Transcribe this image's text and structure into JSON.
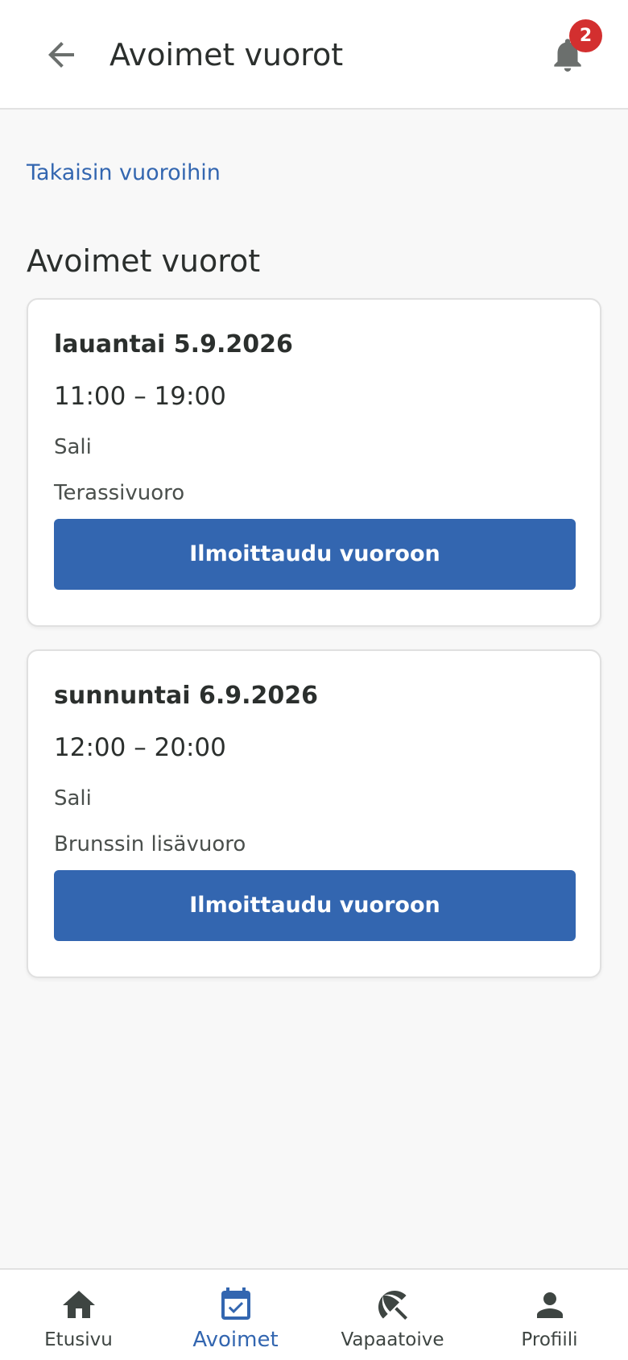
{
  "header": {
    "title": "Avoimet vuorot",
    "back_icon": "arrow-left-icon",
    "bell_icon": "bell-icon",
    "notification_count": "2"
  },
  "back_link": "Takaisin vuoroihin",
  "section_title": "Avoimet vuorot",
  "shifts": [
    {
      "date": "lauantai 5.9.2026",
      "time": "11:00 – 19:00",
      "location": "Sali",
      "description": "Terassivuoro",
      "button_label": "Ilmoittaudu vuoroon"
    },
    {
      "date": "sunnuntai 6.9.2026",
      "time": "12:00 – 20:00",
      "location": "Sali",
      "description": "Brunssin lisävuoro",
      "button_label": "Ilmoittaudu vuoroon"
    }
  ],
  "bottom_nav": {
    "items": [
      {
        "label": "Etusivu",
        "icon": "home-icon",
        "active": false
      },
      {
        "label": "Avoimet",
        "icon": "calendar-check-icon",
        "active": true
      },
      {
        "label": "Vapaatoive",
        "icon": "beach-umbrella-icon",
        "active": false
      },
      {
        "label": "Profiili",
        "icon": "person-icon",
        "active": false
      }
    ]
  },
  "colors": {
    "accent": "#3366b0",
    "badge": "#d32f2f",
    "text": "#2b2f2d",
    "background": "#f8f8f8"
  }
}
